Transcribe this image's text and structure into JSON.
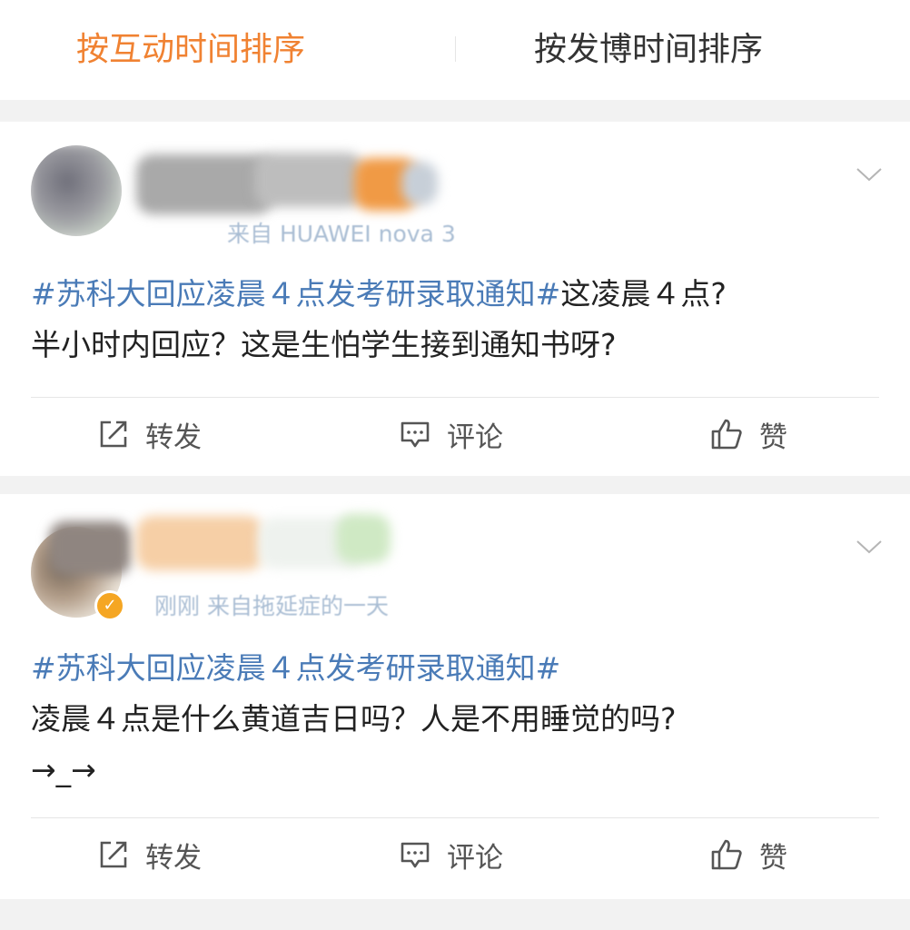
{
  "sort_tabs": {
    "interaction": "按互动时间排序",
    "post_time": "按发博时间排序"
  },
  "colors": {
    "active_tab": "#f08232",
    "hashtag": "#4a7bb7",
    "meta": "#9bb2cc",
    "verified": "#f5a623"
  },
  "posts": [
    {
      "meta": "来自 HUAWEI nova 3",
      "hashtag": "#苏科大回应凌晨４点发考研录取通知#",
      "text_rest": "这凌晨４点?",
      "text_line2": "半小时内回应？这是生怕学生接到通知书呀?",
      "text_line3": "",
      "actions": {
        "repost": "转发",
        "comment": "评论",
        "like": "赞"
      }
    },
    {
      "meta": "刚刚 来自拖延症的一天",
      "hashtag": "#苏科大回应凌晨４点发考研录取通知#",
      "text_rest": "",
      "text_line2": "凌晨４点是什么黄道吉日吗？人是不用睡觉的吗?",
      "text_line3": "→_→",
      "actions": {
        "repost": "转发",
        "comment": "评论",
        "like": "赞"
      }
    }
  ],
  "icons": {
    "repost": "share-box-icon",
    "comment": "comment-bubble-icon",
    "like": "thumbs-up-icon",
    "more": "chevron-down-icon",
    "verified": "verified-badge-icon"
  }
}
